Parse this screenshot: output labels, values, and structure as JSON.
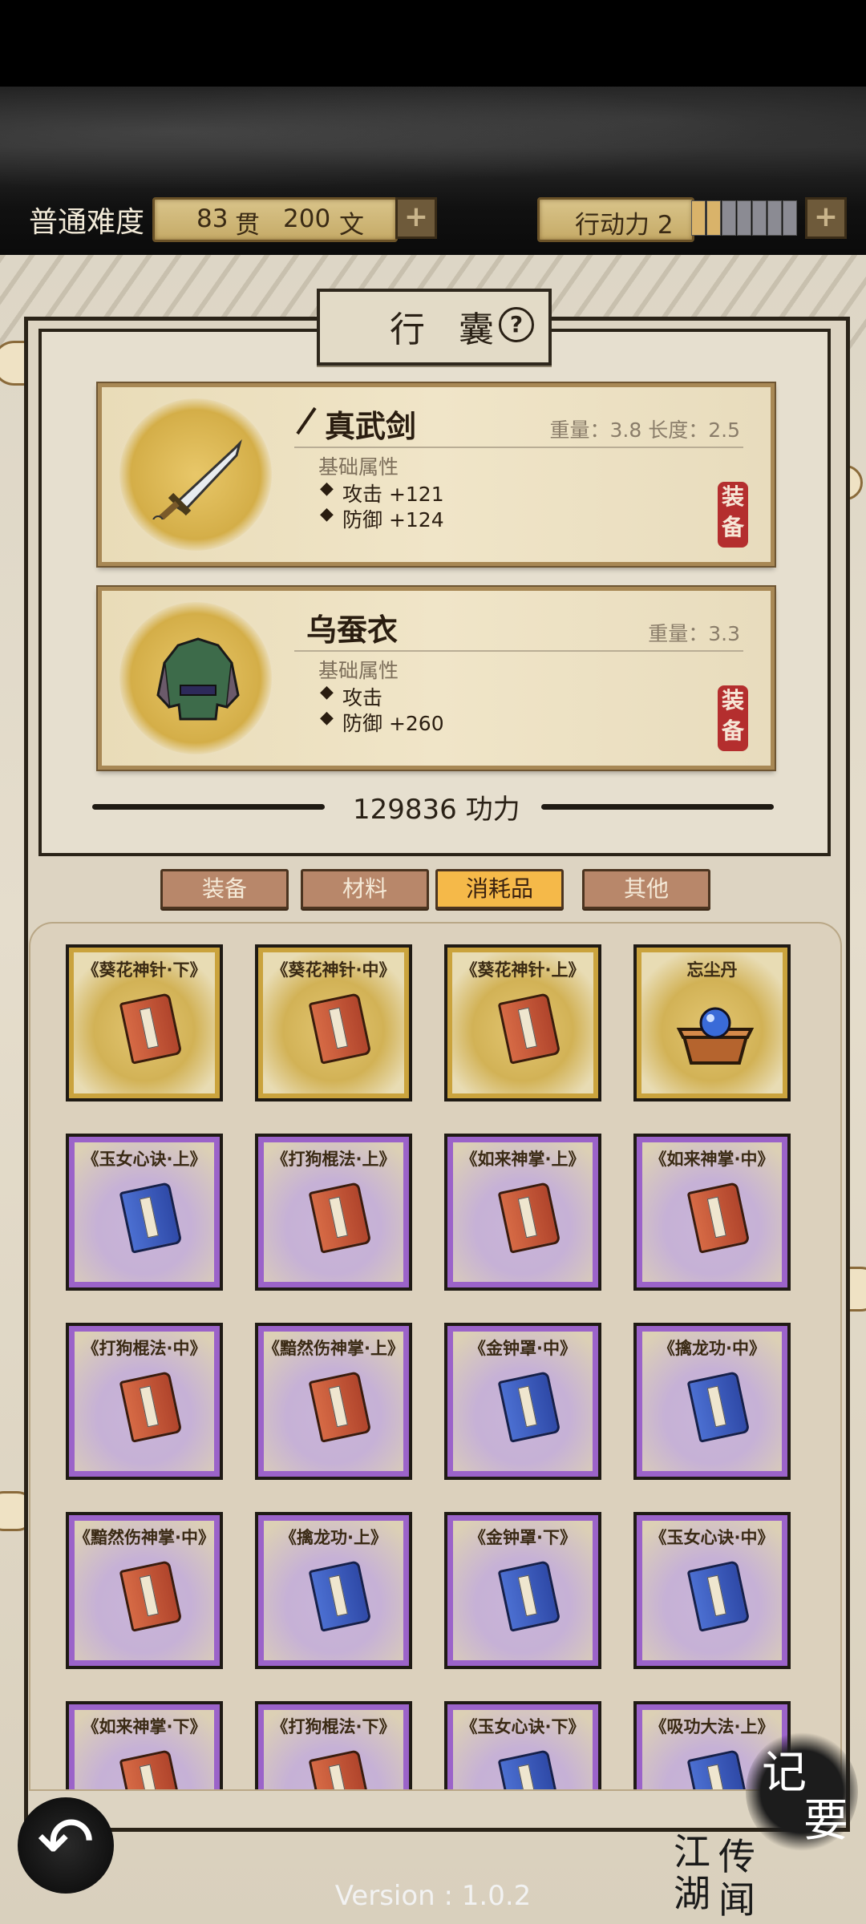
{
  "topbar": {
    "difficulty": "普通难度",
    "money_guan": "83",
    "money_guan_unit": "贯",
    "money_wen": "200",
    "money_wen_unit": "文",
    "action_label": "行动力 2",
    "action_value": 2,
    "action_max": 7
  },
  "panel": {
    "title": "行 囊",
    "help_glyph": "?"
  },
  "equipped": [
    {
      "name": "真武剑",
      "meta": "重量：3.8  长度：2.5",
      "attr_title": "基础属性",
      "attrs": [
        "攻击 +121",
        "防御 +124"
      ],
      "stamp": "装备"
    },
    {
      "name": "乌蚕衣",
      "meta": "重量：3.3",
      "attr_title": "基础属性",
      "attrs": [
        "攻击",
        "防御 +260"
      ],
      "stamp": "装备"
    }
  ],
  "power": "129836 功力",
  "tabs": [
    "装备",
    "材料",
    "消耗品",
    "其他"
  ],
  "active_tab": "消耗品",
  "items": [
    {
      "label": "《葵花神针·下》",
      "rarity": "gold",
      "icon": "red-book"
    },
    {
      "label": "《葵花神针·中》",
      "rarity": "gold",
      "icon": "red-book"
    },
    {
      "label": "《葵花神针·上》",
      "rarity": "gold",
      "icon": "red-book"
    },
    {
      "label": "忘尘丹",
      "rarity": "gold",
      "icon": "pill-box"
    },
    {
      "label": "《玉女心诀·上》",
      "rarity": "purple",
      "icon": "blue-book"
    },
    {
      "label": "《打狗棍法·上》",
      "rarity": "purple",
      "icon": "red-book"
    },
    {
      "label": "《如来神掌·上》",
      "rarity": "purple",
      "icon": "red-book"
    },
    {
      "label": "《如来神掌·中》",
      "rarity": "purple",
      "icon": "red-book"
    },
    {
      "label": "《打狗棍法·中》",
      "rarity": "purple",
      "icon": "red-book"
    },
    {
      "label": "《黯然伤神掌·上》",
      "rarity": "purple",
      "icon": "red-book"
    },
    {
      "label": "《金钟罩·中》",
      "rarity": "purple",
      "icon": "blue-book"
    },
    {
      "label": "《擒龙功·中》",
      "rarity": "purple",
      "icon": "blue-book"
    },
    {
      "label": "《黯然伤神掌·中》",
      "rarity": "purple",
      "icon": "red-book"
    },
    {
      "label": "《擒龙功·上》",
      "rarity": "purple",
      "icon": "blue-book"
    },
    {
      "label": "《金钟罩·下》",
      "rarity": "purple",
      "icon": "blue-book"
    },
    {
      "label": "《玉女心诀·中》",
      "rarity": "purple",
      "icon": "blue-book"
    },
    {
      "label": "《如来神掌·下》",
      "rarity": "purple",
      "icon": "red-book"
    },
    {
      "label": "《打狗棍法·下》",
      "rarity": "purple",
      "icon": "red-book"
    },
    {
      "label": "《玉女心诀·下》",
      "rarity": "purple",
      "icon": "blue-book"
    },
    {
      "label": "《吸功大法·上》",
      "rarity": "purple",
      "icon": "blue-book"
    }
  ],
  "bottom": {
    "back_glyph": "↶",
    "jiyao": [
      "记",
      "要"
    ],
    "jianghu": [
      "江",
      "湖",
      "传",
      "闻"
    ],
    "version": "Version : 1.0.2"
  }
}
